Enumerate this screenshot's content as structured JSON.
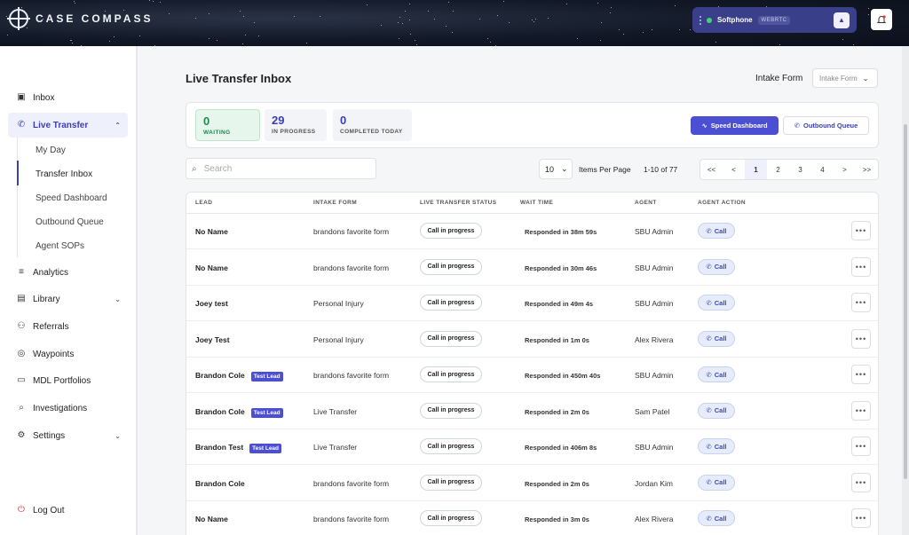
{
  "app": {
    "brand": "CASE COMPASS"
  },
  "softphone": {
    "label": "Softphone",
    "badge": "WEBRTC"
  },
  "sidebar": {
    "items": [
      {
        "label": "Inbox",
        "icon": "inbox-icon"
      },
      {
        "label": "Live Transfer",
        "icon": "phone-icon",
        "expanded": true,
        "active": true
      },
      {
        "label": "Analytics",
        "icon": "analytics-icon"
      },
      {
        "label": "Library",
        "icon": "library-icon"
      },
      {
        "label": "Referrals",
        "icon": "referrals-icon"
      },
      {
        "label": "Waypoints",
        "icon": "compass-icon"
      },
      {
        "label": "MDL Portfolios",
        "icon": "folder-icon"
      },
      {
        "label": "Investigations",
        "icon": "search-icon"
      },
      {
        "label": "Settings",
        "icon": "gear-icon"
      }
    ],
    "sub_items": [
      {
        "label": "My Day"
      },
      {
        "label": "Transfer Inbox",
        "active": true
      },
      {
        "label": "Speed Dashboard"
      },
      {
        "label": "Outbound Queue"
      },
      {
        "label": "Agent SOPs"
      }
    ],
    "logout": "Log Out"
  },
  "page": {
    "title": "Live Transfer Inbox",
    "intake_label": "Intake Form",
    "intake_select": "Intake Form"
  },
  "stats": [
    {
      "value": "0",
      "label": "WAITING",
      "color": "#1f8a4c"
    },
    {
      "value": "29",
      "label": "IN PROGRESS",
      "color": "#3b3fb6"
    },
    {
      "value": "0",
      "label": "COMPLETED TODAY",
      "color": "#3b3fb6"
    }
  ],
  "actions": {
    "speed_dashboard": "Speed Dashboard",
    "outbound_queue": "Outbound Queue"
  },
  "search": {
    "placeholder": "Search"
  },
  "pagination": {
    "page_size": "10",
    "items_per_page": "Items Per Page",
    "range": "1-10 of 77",
    "buttons": [
      "<<",
      "<",
      "1",
      "2",
      "3",
      "4",
      ">",
      ">>"
    ],
    "current": "1"
  },
  "table": {
    "headers": [
      "LEAD",
      "INTAKE FORM",
      "LIVE TRANSFER STATUS",
      "WAIT TIME",
      "AGENT",
      "AGENT ACTION"
    ],
    "call_label": "Call",
    "rows": [
      {
        "lead": "No Name",
        "tag": "",
        "form": "brandons favorite form",
        "status": "Call in progress",
        "wait": "Responded in 38m 59s",
        "agent": "SBU Admin"
      },
      {
        "lead": "No Name",
        "tag": "",
        "form": "brandons favorite form",
        "status": "Call in progress",
        "wait": "Responded in 30m 46s",
        "agent": "SBU Admin"
      },
      {
        "lead": "Joey test",
        "tag": "",
        "form": "Personal Injury",
        "status": "Call in progress",
        "wait": "Responded in 49m 4s",
        "agent": "SBU Admin"
      },
      {
        "lead": "Joey Test",
        "tag": "",
        "form": "Personal Injury",
        "status": "Call in progress",
        "wait": "Responded in 1m 0s",
        "agent": "Alex Rivera"
      },
      {
        "lead": "Brandon Cole",
        "tag": "Test Lead",
        "form": "brandons favorite form",
        "status": "Call in progress",
        "wait": "Responded in 450m 40s",
        "agent": "SBU Admin"
      },
      {
        "lead": "Brandon Cole",
        "tag": "Test Lead",
        "form": "Live Transfer",
        "status": "Call in progress",
        "wait": "Responded in 2m 0s",
        "agent": "Sam Patel"
      },
      {
        "lead": "Brandon Test",
        "tag": "Test Lead",
        "form": "Live Transfer",
        "status": "Call in progress",
        "wait": "Responded in 406m 8s",
        "agent": "SBU Admin"
      },
      {
        "lead": "Brandon Cole",
        "tag": "",
        "form": "brandons favorite form",
        "status": "Call in progress",
        "wait": "Responded in 2m 0s",
        "agent": "Jordan Kim"
      },
      {
        "lead": "No Name",
        "tag": "",
        "form": "brandons favorite form",
        "status": "Call in progress",
        "wait": "Responded in 3m 0s",
        "agent": "Alex Rivera"
      }
    ]
  },
  "colors": {
    "accent": "#4c4fd1",
    "accent_text": "#3b3fb6",
    "waiting_bg": "#e6f6ec",
    "stat_bg": "#f3f4f7"
  }
}
